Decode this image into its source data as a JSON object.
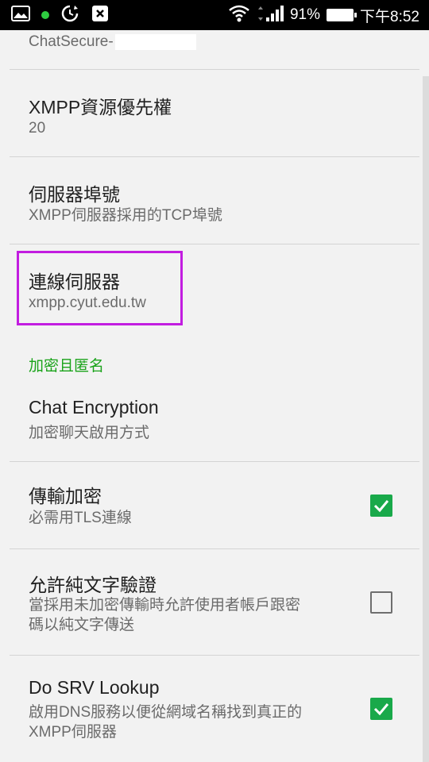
{
  "status_bar": {
    "battery_percent": "91%",
    "time": "下午8:52",
    "icons": [
      "gallery-icon",
      "notification-dot-icon",
      "sync-icon",
      "app-update-icon",
      "wifi-icon",
      "signal-icon",
      "battery-icon"
    ]
  },
  "preferences": {
    "account_name": "ChatSecure-",
    "priority": {
      "title": "XMPP資源優先權",
      "summary": "20"
    },
    "port": {
      "title": "伺服器埠號",
      "summary": "XMPP伺服器採用的TCP埠號"
    },
    "server": {
      "title": "連線伺服器",
      "summary": "xmpp.cyut.edu.tw"
    },
    "category_label": "加密且匿名",
    "chat_encryption": {
      "title": "Chat Encryption",
      "summary": "加密聊天啟用方式"
    },
    "require_tls": {
      "title": "傳輸加密",
      "summary": "必需用TLS連線",
      "checked": true
    },
    "allow_plain_auth": {
      "title": "允許純文字驗證",
      "summary_line1": "當採用未加密傳輸時允許使用者帳戶跟密",
      "summary_line2": "碼以純文字傳送",
      "checked": false
    },
    "srv_lookup": {
      "title": "Do SRV Lookup",
      "summary_line1": "啟用DNS服務以便從網域名稱找到真正的",
      "summary_line2": "XMPP伺服器",
      "checked": true
    }
  },
  "colors": {
    "accent_green": "#19a94a",
    "category_green": "#1aa31a",
    "highlight_purple": "#c21de0"
  }
}
